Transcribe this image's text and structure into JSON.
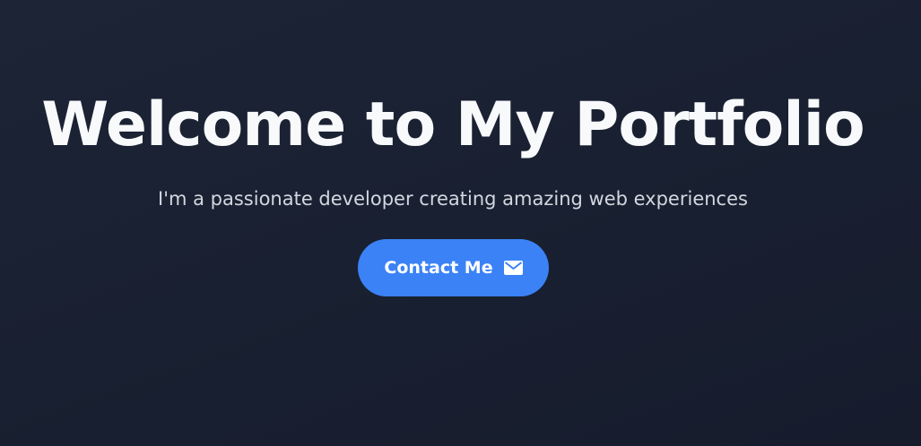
{
  "hero": {
    "title": "Welcome to My Portfolio",
    "subtitle": "I'm a passionate developer creating amazing web experiences",
    "cta": {
      "label": "Contact Me",
      "icon": "envelope-icon"
    }
  },
  "colors": {
    "background": "#1a2133",
    "accent": "#3b82f6",
    "title": "#f8f9fb",
    "subtitle": "#d3d7df"
  }
}
